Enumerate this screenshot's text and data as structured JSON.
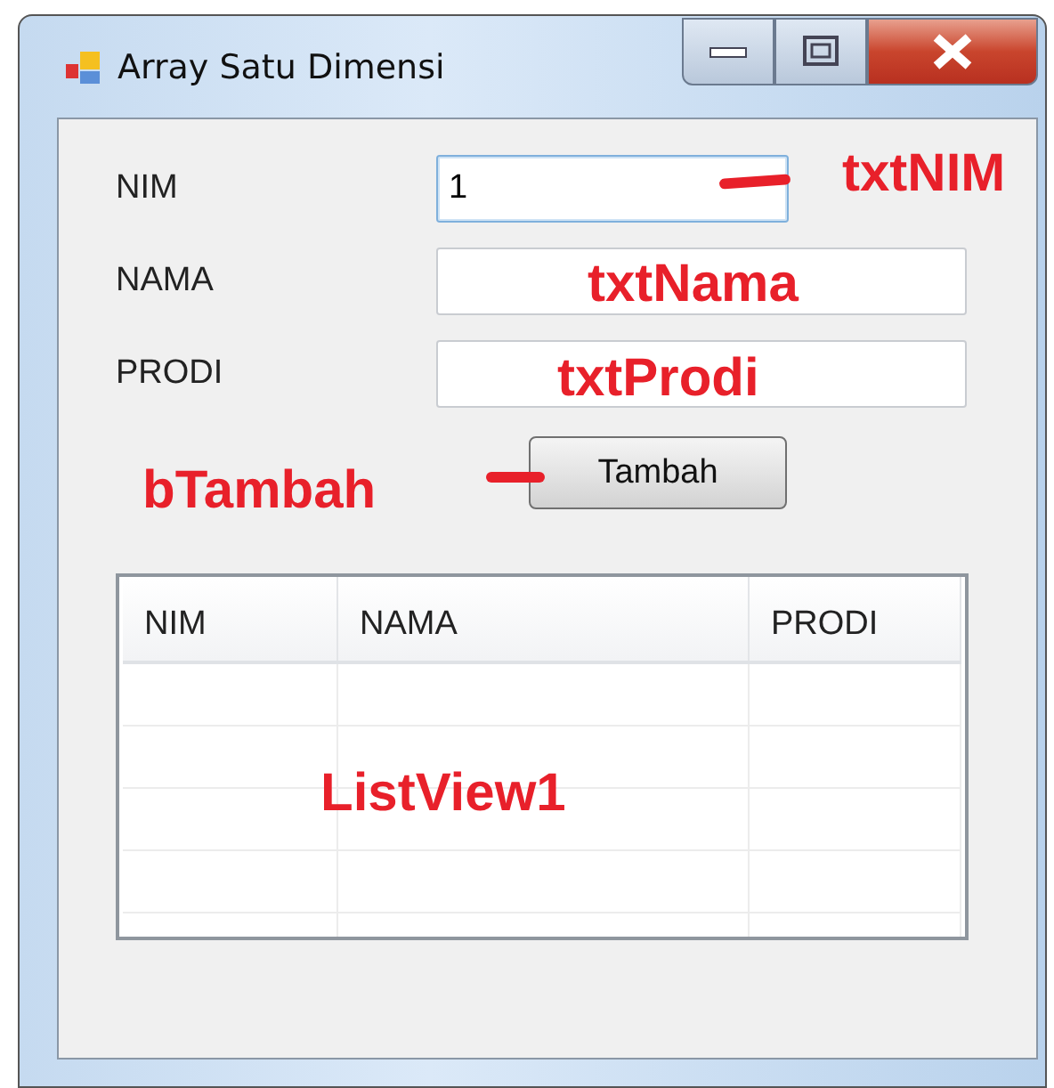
{
  "window": {
    "title": "Array Satu Dimensi"
  },
  "fields": [
    {
      "label": "NIM",
      "value": "1",
      "focused": true
    },
    {
      "label": "NAMA",
      "focused": false
    },
    {
      "label": "PRODI",
      "focused": false
    }
  ],
  "button": {
    "label": "Tambah"
  },
  "list_view": {
    "columns": [
      "NIM",
      "NAMA",
      "PRODI"
    ]
  },
  "annotations": [
    {
      "text": "txtNIM",
      "kind": "pointer"
    },
    {
      "text": "txtNama",
      "kind": "label"
    },
    {
      "text": "txtProdi",
      "kind": "label"
    },
    {
      "text": "bTambah",
      "kind": "pointer"
    },
    {
      "text": "ListView1",
      "kind": "label"
    }
  ]
}
